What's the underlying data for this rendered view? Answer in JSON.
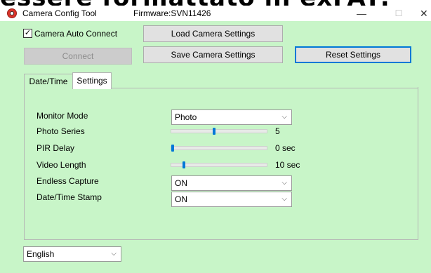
{
  "background_artifact": "essere formattato in exFAT:",
  "window": {
    "title": "Camera Config Tool",
    "firmware": "Firmware:SVN11426",
    "min_glyph": "—",
    "max_glyph": "☐",
    "close_glyph": "✕"
  },
  "toolbar": {
    "auto_connect_label": "Camera Auto Connect",
    "auto_connect_checked": true,
    "check_glyph": "✓",
    "connect_label": "Connect",
    "load_label": "Load Camera Settings",
    "save_label": "Save Camera Settings",
    "reset_label": "Reset Settings"
  },
  "tabs": [
    {
      "label": "Date/Time",
      "active": false
    },
    {
      "label": "Settings",
      "active": true
    }
  ],
  "settings": {
    "monitor_mode": {
      "label": "Monitor Mode",
      "value": "Photo"
    },
    "photo_series": {
      "label": "Photo Series",
      "value": "5",
      "level": 0.45
    },
    "pir_delay": {
      "label": "PIR Delay",
      "value": "0 sec",
      "level": 0.0
    },
    "video_length": {
      "label": "Video Length",
      "value": "10 sec",
      "level": 0.12
    },
    "endless_capture": {
      "label": "Endless Capture",
      "value": "ON"
    },
    "datetime_stamp": {
      "label": "Date/Time Stamp",
      "value": "ON"
    }
  },
  "language": {
    "value": "English"
  },
  "chevron_glyph": "⌵",
  "colors": {
    "window_bg": "#c8f5c8",
    "accent": "#0078d7",
    "button_bg": "#e1e1e1"
  }
}
